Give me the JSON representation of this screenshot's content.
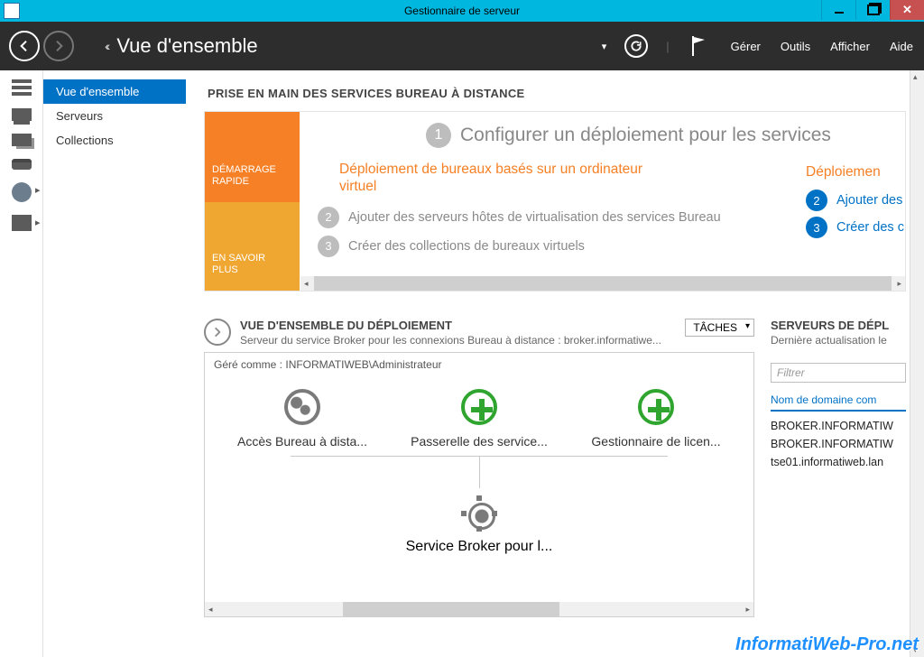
{
  "window": {
    "title": "Gestionnaire de serveur"
  },
  "header": {
    "breadcrumb_prefix": "‹‹",
    "breadcrumb": "Vue d'ensemble",
    "menus": [
      "Gérer",
      "Outils",
      "Afficher",
      "Aide"
    ]
  },
  "sidebar": {
    "items": [
      "Vue d'ensemble",
      "Serveurs",
      "Collections"
    ],
    "active_index": 0
  },
  "quickstart": {
    "section_label": "PRISE EN MAIN DES SERVICES BUREAU À DISTANCE",
    "left_orange": "DÉMARRAGE RAPIDE",
    "left_yellow": "EN SAVOIR PLUS",
    "heading_num": "1",
    "heading": "Configurer un déploiement pour les services",
    "col1_title": "Déploiement de bureaux basés sur un ordinateur virtuel",
    "col1_steps": [
      {
        "num": "2",
        "label": "Ajouter des serveurs hôtes de virtualisation des services Bureau"
      },
      {
        "num": "3",
        "label": "Créer des collections de bureaux virtuels"
      }
    ],
    "col2_title": "Déploiemen",
    "col2_steps": [
      {
        "num": "2",
        "label": "Ajouter des"
      },
      {
        "num": "3",
        "label": "Créer des c"
      }
    ]
  },
  "deployment": {
    "title": "VUE D'ENSEMBLE DU DÉPLOIEMENT",
    "subtitle": "Serveur du service Broker pour les connexions Bureau à distance : broker.informatiwe...",
    "tasks_label": "TÂCHES",
    "managed_as": "Géré comme : INFORMATIWEB\\Administrateur",
    "nodes": [
      {
        "icon": "globe",
        "label": "Accès Bureau à dista..."
      },
      {
        "icon": "plus",
        "label": "Passerelle des service..."
      },
      {
        "icon": "plus",
        "label": "Gestionnaire de licen..."
      }
    ],
    "broker_label": "Service Broker pour l..."
  },
  "servers_panel": {
    "title": "SERVEURS DE DÉPL",
    "subtitle": "Dernière actualisation le",
    "filter_placeholder": "Filtrer",
    "column": "Nom de domaine com",
    "rows": [
      "BROKER.INFORMATIW",
      "BROKER.INFORMATIW",
      "tse01.informatiweb.lan"
    ]
  },
  "watermark": "InformatiWeb-Pro.net"
}
